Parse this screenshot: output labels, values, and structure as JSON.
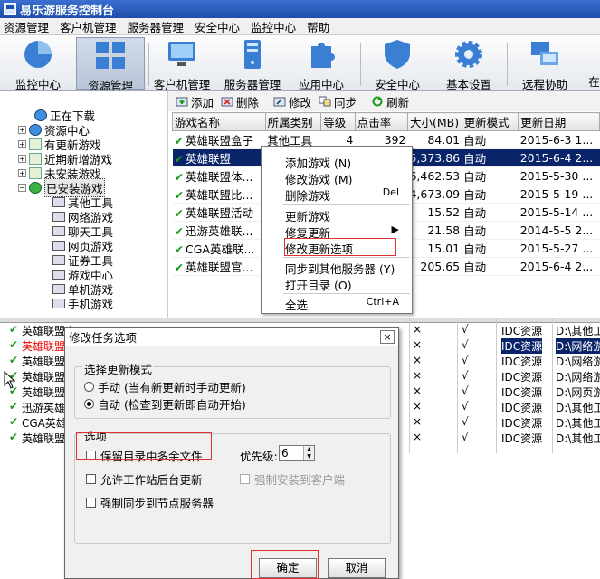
{
  "app": {
    "title": "易乐游服务控制台"
  },
  "menu": [
    "资源管理",
    "客户机管理",
    "服务器管理",
    "安全中心",
    "监控中心",
    "帮助"
  ],
  "toolbar": [
    {
      "label": "监控中心",
      "icon": "pie-chart-icon"
    },
    {
      "label": "资源管理",
      "icon": "grid-icon",
      "active": true
    },
    {
      "label": "客户机管理",
      "icon": "monitor-icon"
    },
    {
      "label": "服务器管理",
      "icon": "server-icon"
    },
    {
      "label": "应用中心",
      "icon": "puzzle-icon"
    },
    {
      "label": "安全中心",
      "icon": "shield-icon"
    },
    {
      "label": "基本设置",
      "icon": "gear-icon"
    },
    {
      "label": "远程协助",
      "icon": "remote-icon"
    },
    {
      "label": "在",
      "icon": ""
    }
  ],
  "tree": {
    "nodes": [
      "正在下载",
      "资源中心",
      "有更新游戏",
      "近期新增游戏",
      "未安装游戏",
      "已安装游戏"
    ],
    "children": [
      "其他工具",
      "网络游戏",
      "聊天工具",
      "网页游戏",
      "证券工具",
      "游戏中心",
      "单机游戏",
      "手机游戏"
    ]
  },
  "actions": [
    "添加",
    "删除",
    "修改",
    "同步",
    "刷新"
  ],
  "table": {
    "columns": [
      "游戏名称",
      "所属类别",
      "等级",
      "点击率",
      "大小(MB)",
      "更新模式",
      "更新日期"
    ],
    "rows": [
      [
        "英雄联盟盒子",
        "其他工具",
        "4",
        "392",
        "84.01",
        "自动",
        "2015-6-3 1..."
      ],
      [
        "英雄联盟",
        "",
        "",
        "",
        "5,373.86",
        "自动",
        "2015-6-4 2..."
      ],
      [
        "英雄联盟体...",
        "",
        "",
        "",
        "6,462.53",
        "自动",
        "2015-5-30 ..."
      ],
      [
        "英雄联盟比...",
        "",
        "",
        "",
        "4,673.09",
        "自动",
        "2015-5-19 ..."
      ],
      [
        "英雄联盟活动",
        "",
        "",
        "",
        "15.52",
        "自动",
        "2015-5-14 ..."
      ],
      [
        "迅游英雄联...",
        "",
        "",
        "",
        "21.58",
        "自动",
        "2014-5-5 2..."
      ],
      [
        "CGA英雄联...",
        "",
        "",
        "",
        "15.01",
        "自动",
        "2015-5-27 ..."
      ],
      [
        "英雄联盟官...",
        "",
        "",
        "",
        "205.65",
        "自动",
        "2015-6-4 2..."
      ]
    ]
  },
  "context_menu": {
    "items": [
      "添加游戏 (N)",
      "修改游戏 (M)",
      "删除游戏",
      "更新游戏",
      "修复更新",
      "修改更新选项",
      "同步到其他服务器 (Y)",
      "打开目录 (O)",
      "全选"
    ],
    "shortcuts": {
      "delete": "Del",
      "select_all": "Ctrl+A"
    }
  },
  "lower": {
    "rows": [
      {
        "name": "英雄联盟盒",
        "x": "×",
        "v": "√",
        "src": "IDC资源",
        "path": "D:\\其他工"
      },
      {
        "name": "英雄联盟",
        "x": "×",
        "v": "√",
        "src": "IDC资源",
        "path": "D:\\网络游"
      },
      {
        "name": "英雄联盟",
        "x": "×",
        "v": "√",
        "src": "IDC资源",
        "path": "D:\\网络游"
      },
      {
        "name": "英雄联盟",
        "x": "×",
        "v": "√",
        "src": "IDC资源",
        "path": "D:\\网络游"
      },
      {
        "name": "英雄联盟",
        "x": "×",
        "v": "√",
        "src": "IDC资源",
        "path": "D:\\网页游"
      },
      {
        "name": "迅游英雄",
        "x": "×",
        "v": "√",
        "src": "IDC资源",
        "path": "D:\\其他工"
      },
      {
        "name": "CGA英雄I",
        "x": "×",
        "v": "√",
        "src": "IDC资源",
        "path": "D:\\其他工"
      },
      {
        "name": "英雄联盟",
        "x": "×",
        "v": "√",
        "src": "IDC资源",
        "path": "D:\\其他工"
      }
    ]
  },
  "dialog": {
    "title": "修改任务选项",
    "close": "×",
    "update_group": "选择更新模式",
    "manual": "手动 (当有新更新时手动更新)",
    "auto": "自动 (检查到更新即自动开始)",
    "options_group": "选项",
    "keep_files": "保留目录中多余文件",
    "allow_bg": "允许工作站后台更新",
    "force_sync": "强制同步到节点服务器",
    "priority_label": "优先级:",
    "priority_value": "6",
    "force_install": "强制安装到客户端",
    "ok": "确定",
    "cancel": "取消"
  }
}
